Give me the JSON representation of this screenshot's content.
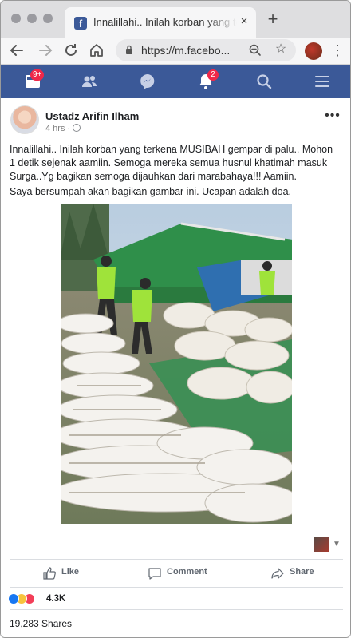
{
  "browser": {
    "tab_title": "Innalillahi.. Inilah korban yang te",
    "close_glyph": "×",
    "new_tab_glyph": "+",
    "url": "https://m.facebo...",
    "icons": [
      "back-icon",
      "forward-icon",
      "reload-icon",
      "home-icon",
      "lock-icon",
      "zoom-icon",
      "star-icon",
      "menu-icon"
    ]
  },
  "fbnav": {
    "home_badge": "9+",
    "notifications_badge": "2",
    "bar_color": "#3b5998"
  },
  "post": {
    "author": "Ustadz Arifin Ilham",
    "time": "4 hrs ·",
    "text": "Innalillahi.. Inilah korban yang terkena MUSIBAH gempar di palu.. Mohon 1 detik sejenak aamiin. Semoga mereka semua husnul khatimah masuk Surga..Yg bagikan semoga dijauhkan dari marabahaya!!! Aamiin.",
    "text2": "Saya bersumpah akan bagikan gambar ini. Ucapan adalah doa.",
    "more_glyph": "•••"
  },
  "actions": {
    "like": "Like",
    "comment": "Comment",
    "share": "Share"
  },
  "stats": {
    "reaction_count": "4.3K",
    "shares": "19,283 Shares",
    "reactions": [
      "like",
      "sad",
      "love"
    ]
  }
}
